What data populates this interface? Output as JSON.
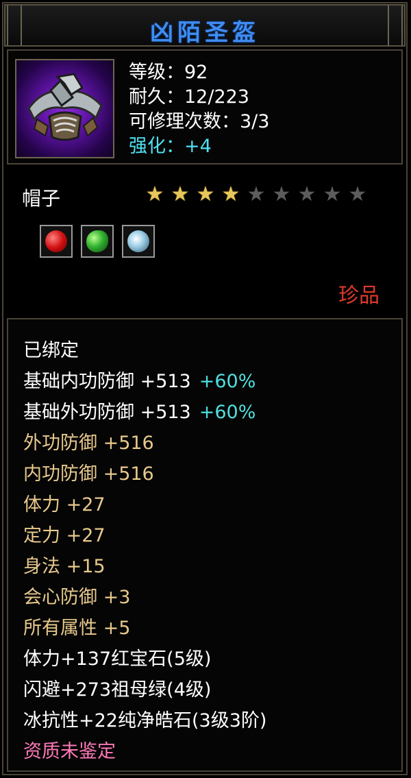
{
  "title": "凶陌圣盔",
  "item": {
    "icon": "helmet-icon",
    "stats": [
      {
        "text": "等级：92",
        "color": "white"
      },
      {
        "text": "耐久：12/223",
        "color": "white"
      },
      {
        "text": "可修理次数：3/3",
        "color": "white"
      },
      {
        "text": "强化：+4",
        "color": "cyan"
      }
    ]
  },
  "category": "帽子",
  "stars": {
    "filled": 4,
    "total": 9
  },
  "gems": [
    {
      "name": "red-gem-icon",
      "color": "#d01010"
    },
    {
      "name": "green-gem-icon",
      "color": "#30b030"
    },
    {
      "name": "white-gem-icon",
      "color": "#9fd0e8"
    }
  ],
  "rarity": "珍品",
  "attributes": [
    {
      "text": "已绑定",
      "bonus": "",
      "color": "white"
    },
    {
      "text": "基础内功防御 +513",
      "bonus": "+60%",
      "color": "white"
    },
    {
      "text": "基础外功防御 +513",
      "bonus": "+60%",
      "color": "white"
    },
    {
      "text": "外功防御 +516",
      "bonus": "",
      "color": "gold"
    },
    {
      "text": "内功防御 +516",
      "bonus": "",
      "color": "gold"
    },
    {
      "text": "体力 +27",
      "bonus": "",
      "color": "gold"
    },
    {
      "text": "定力 +27",
      "bonus": "",
      "color": "gold"
    },
    {
      "text": "身法 +15",
      "bonus": "",
      "color": "gold"
    },
    {
      "text": "会心防御 +3",
      "bonus": "",
      "color": "gold"
    },
    {
      "text": "所有属性 +5",
      "bonus": "",
      "color": "gold"
    },
    {
      "text": "体力+137红宝石(5级)",
      "bonus": "",
      "color": "white"
    },
    {
      "text": "闪避+273祖母绿(4级)",
      "bonus": "",
      "color": "white"
    },
    {
      "text": "冰抗性+22纯净皓石(3级3阶)",
      "bonus": "",
      "color": "white"
    },
    {
      "text": "资质未鉴定",
      "bonus": "",
      "color": "pink"
    }
  ],
  "colors": {
    "title": "#3f8cf2",
    "rarity": "#e03a2a",
    "enhance": "#4fe0f0",
    "gold_text": "#e8c98c",
    "pink_text": "#ff7ab8"
  }
}
